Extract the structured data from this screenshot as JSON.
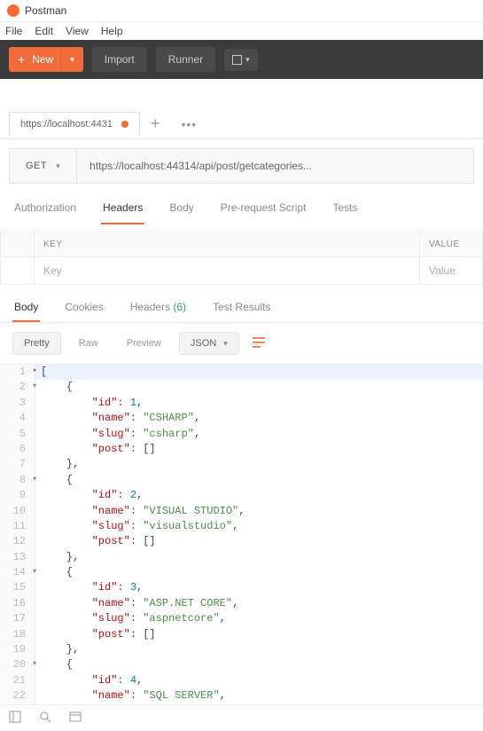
{
  "title": "Postman",
  "menu": {
    "file": "File",
    "edit": "Edit",
    "view": "View",
    "help": "Help"
  },
  "toolbar": {
    "new": "New",
    "import": "Import",
    "runner": "Runner"
  },
  "tab": {
    "label": "https://localhost:4431"
  },
  "request": {
    "method": "GET",
    "url": "https://localhost:44314/api/post/getcategories..."
  },
  "reqtabs": {
    "auth": "Authorization",
    "headers": "Headers",
    "body": "Body",
    "prereq": "Pre-request Script",
    "tests": "Tests"
  },
  "kv": {
    "key_head": "KEY",
    "val_head": "VALUE",
    "key_ph": "Key",
    "val_ph": "Value"
  },
  "resptabs": {
    "body": "Body",
    "cookies": "Cookies",
    "headers": "Headers",
    "headers_count": "(6)",
    "tests": "Test Results"
  },
  "viewbar": {
    "pretty": "Pretty",
    "raw": "Raw",
    "preview": "Preview",
    "format": "JSON"
  },
  "json_lines": [
    {
      "n": 1,
      "f": true,
      "t": "[",
      "tokens": [
        {
          "c": "",
          "v": "["
        }
      ]
    },
    {
      "n": 2,
      "f": true,
      "t": "    {",
      "tokens": [
        {
          "c": "",
          "v": "    {"
        }
      ]
    },
    {
      "n": 3,
      "t": "        \"id\": 1,",
      "tokens": [
        {
          "c": "",
          "v": "        "
        },
        {
          "c": "k",
          "v": "\"id\""
        },
        {
          "c": "",
          "v": ": "
        },
        {
          "c": "n",
          "v": "1"
        },
        {
          "c": "",
          "v": ","
        }
      ]
    },
    {
      "n": 4,
      "t": "        \"name\": \"CSHARP\",",
      "tokens": [
        {
          "c": "",
          "v": "        "
        },
        {
          "c": "k",
          "v": "\"name\""
        },
        {
          "c": "",
          "v": ": "
        },
        {
          "c": "s",
          "v": "\"CSHARP\""
        },
        {
          "c": "",
          "v": ","
        }
      ]
    },
    {
      "n": 5,
      "t": "        \"slug\": \"csharp\",",
      "tokens": [
        {
          "c": "",
          "v": "        "
        },
        {
          "c": "k",
          "v": "\"slug\""
        },
        {
          "c": "",
          "v": ": "
        },
        {
          "c": "s",
          "v": "\"csharp\""
        },
        {
          "c": "",
          "v": ","
        }
      ]
    },
    {
      "n": 6,
      "t": "        \"post\": []",
      "tokens": [
        {
          "c": "",
          "v": "        "
        },
        {
          "c": "k",
          "v": "\"post\""
        },
        {
          "c": "",
          "v": ": []"
        }
      ]
    },
    {
      "n": 7,
      "t": "    },",
      "tokens": [
        {
          "c": "",
          "v": "    },"
        }
      ]
    },
    {
      "n": 8,
      "f": true,
      "t": "    {",
      "tokens": [
        {
          "c": "",
          "v": "    {"
        }
      ]
    },
    {
      "n": 9,
      "t": "        \"id\": 2,",
      "tokens": [
        {
          "c": "",
          "v": "        "
        },
        {
          "c": "k",
          "v": "\"id\""
        },
        {
          "c": "",
          "v": ": "
        },
        {
          "c": "n",
          "v": "2"
        },
        {
          "c": "",
          "v": ","
        }
      ]
    },
    {
      "n": 10,
      "t": "        \"name\": \"VISUAL STUDIO\",",
      "tokens": [
        {
          "c": "",
          "v": "        "
        },
        {
          "c": "k",
          "v": "\"name\""
        },
        {
          "c": "",
          "v": ": "
        },
        {
          "c": "s",
          "v": "\"VISUAL STUDIO\""
        },
        {
          "c": "",
          "v": ","
        }
      ]
    },
    {
      "n": 11,
      "t": "        \"slug\": \"visualstudio\",",
      "tokens": [
        {
          "c": "",
          "v": "        "
        },
        {
          "c": "k",
          "v": "\"slug\""
        },
        {
          "c": "",
          "v": ": "
        },
        {
          "c": "s",
          "v": "\"visualstudio\""
        },
        {
          "c": "",
          "v": ","
        }
      ]
    },
    {
      "n": 12,
      "t": "        \"post\": []",
      "tokens": [
        {
          "c": "",
          "v": "        "
        },
        {
          "c": "k",
          "v": "\"post\""
        },
        {
          "c": "",
          "v": ": []"
        }
      ]
    },
    {
      "n": 13,
      "t": "    },",
      "tokens": [
        {
          "c": "",
          "v": "    },"
        }
      ]
    },
    {
      "n": 14,
      "f": true,
      "t": "    {",
      "tokens": [
        {
          "c": "",
          "v": "    {"
        }
      ]
    },
    {
      "n": 15,
      "t": "        \"id\": 3,",
      "tokens": [
        {
          "c": "",
          "v": "        "
        },
        {
          "c": "k",
          "v": "\"id\""
        },
        {
          "c": "",
          "v": ": "
        },
        {
          "c": "n",
          "v": "3"
        },
        {
          "c": "",
          "v": ","
        }
      ]
    },
    {
      "n": 16,
      "t": "        \"name\": \"ASP.NET CORE\",",
      "tokens": [
        {
          "c": "",
          "v": "        "
        },
        {
          "c": "k",
          "v": "\"name\""
        },
        {
          "c": "",
          "v": ": "
        },
        {
          "c": "s",
          "v": "\"ASP.NET CORE\""
        },
        {
          "c": "",
          "v": ","
        }
      ]
    },
    {
      "n": 17,
      "t": "        \"slug\": \"aspnetcore\",",
      "tokens": [
        {
          "c": "",
          "v": "        "
        },
        {
          "c": "k",
          "v": "\"slug\""
        },
        {
          "c": "",
          "v": ": "
        },
        {
          "c": "s",
          "v": "\"aspnetcore\""
        },
        {
          "c": "",
          "v": ","
        }
      ]
    },
    {
      "n": 18,
      "t": "        \"post\": []",
      "tokens": [
        {
          "c": "",
          "v": "        "
        },
        {
          "c": "k",
          "v": "\"post\""
        },
        {
          "c": "",
          "v": ": []"
        }
      ]
    },
    {
      "n": 19,
      "t": "    },",
      "tokens": [
        {
          "c": "",
          "v": "    },"
        }
      ]
    },
    {
      "n": 20,
      "f": true,
      "t": "    {",
      "tokens": [
        {
          "c": "",
          "v": "    {"
        }
      ]
    },
    {
      "n": 21,
      "t": "        \"id\": 4,",
      "tokens": [
        {
          "c": "",
          "v": "        "
        },
        {
          "c": "k",
          "v": "\"id\""
        },
        {
          "c": "",
          "v": ": "
        },
        {
          "c": "n",
          "v": "4"
        },
        {
          "c": "",
          "v": ","
        }
      ]
    },
    {
      "n": 22,
      "t": "        \"name\": \"SQL SERVER\",",
      "tokens": [
        {
          "c": "",
          "v": "        "
        },
        {
          "c": "k",
          "v": "\"name\""
        },
        {
          "c": "",
          "v": ": "
        },
        {
          "c": "s",
          "v": "\"SQL SERVER\""
        },
        {
          "c": "",
          "v": ","
        }
      ]
    }
  ]
}
